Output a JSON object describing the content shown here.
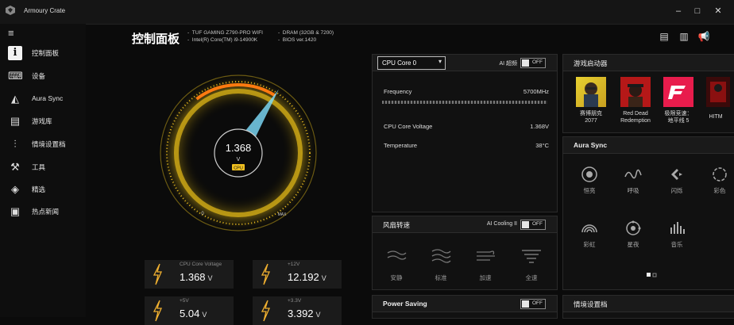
{
  "window": {
    "title": "Armoury Crate"
  },
  "sidebar": {
    "items": [
      {
        "label": "控制面板",
        "icon": "dashboard-icon"
      },
      {
        "label": "设备",
        "icon": "device-icon"
      },
      {
        "label": "Aura Sync",
        "icon": "aura-icon"
      },
      {
        "label": "游戏库",
        "icon": "game-library-icon"
      },
      {
        "label": "情境设置档",
        "icon": "scenario-icon"
      },
      {
        "label": "工具",
        "icon": "tools-icon"
      },
      {
        "label": "精选",
        "icon": "tag-icon"
      },
      {
        "label": "热点新闻",
        "icon": "news-icon"
      }
    ]
  },
  "header": {
    "title": "控制面板",
    "specs": [
      "TUF GAMING Z790-PRO WIFI",
      "Intel(R) Core(TM) i9-14900K",
      "DRAM (32GB & 7200)",
      "BIOS ver.1420"
    ]
  },
  "gauge": {
    "value": "1.368",
    "unit": "V",
    "tag": "CPU",
    "min_label": "0",
    "max_label": "MAX",
    "level": 0.62
  },
  "stats": [
    {
      "label": "CPU Core Voltage",
      "value": "1.368",
      "unit": "V"
    },
    {
      "label": "+12V",
      "value": "12.192",
      "unit": "V"
    },
    {
      "label": "+5V",
      "value": "5.04",
      "unit": "V"
    },
    {
      "label": "+3.3V",
      "value": "3.392",
      "unit": "V"
    }
  ],
  "cpu_panel": {
    "select": "CPU Core 0",
    "toggle_label": "AI 超频",
    "toggle_state": "OFF",
    "frequency_label": "Frequency",
    "frequency_value": "5700MHz",
    "voltage_label": "CPU Core Voltage",
    "voltage_value": "1.368V",
    "temperature_label": "Temperature",
    "temperature_value": "38°C"
  },
  "fan_panel": {
    "title": "风扇转速",
    "toggle_label": "AI Cooling II",
    "toggle_state": "OFF",
    "modes": [
      "安静",
      "标准",
      "加速",
      "全速"
    ]
  },
  "power_panel": {
    "title": "Power Saving",
    "toggle_state": "OFF"
  },
  "games_panel": {
    "title": "游戏启动器",
    "games": [
      {
        "line1": "赛博朋克",
        "line2": "2077"
      },
      {
        "line1": "Red Dead",
        "line2": "Redemption"
      },
      {
        "line1": "极限竞速：",
        "line2": "地平线 5"
      },
      {
        "line1": "HITM",
        "line2": ""
      }
    ]
  },
  "aura_panel": {
    "title": "Aura Sync",
    "effects": [
      "恒亮",
      "呼吸",
      "闪烁",
      "彩色",
      "彩虹",
      "星夜",
      "音乐"
    ]
  },
  "scenario_panel": {
    "title": "情境设置档"
  },
  "colors": {
    "accent": "#f0c020",
    "background": "#0b0b0b",
    "panel": "#111111",
    "gauge_cyan": "#7fe0ff",
    "gauge_orange": "#ff7a10"
  }
}
